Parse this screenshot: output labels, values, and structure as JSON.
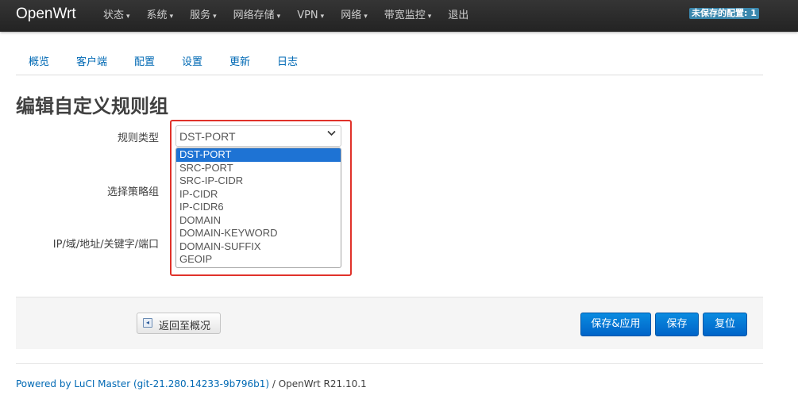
{
  "navbar": {
    "brand": "OpenWrt",
    "menu": [
      "状态",
      "系统",
      "服务",
      "网络存储",
      "VPN",
      "网络",
      "带宽监控",
      "退出"
    ],
    "unsaved_badge": "未保存的配置: 1"
  },
  "tabs": [
    "概览",
    "客户端",
    "配置",
    "设置",
    "更新",
    "日志"
  ],
  "page": {
    "title": "编辑自定义规则组"
  },
  "form": {
    "rule_type_label": "规则类型",
    "policy_group_label": "选择策略组",
    "target_label": "IP/域/地址/关键字/端口",
    "rule_type_selected": "DST-PORT",
    "rule_type_options": [
      "DST-PORT",
      "SRC-PORT",
      "SRC-IP-CIDR",
      "IP-CIDR",
      "IP-CIDR6",
      "DOMAIN",
      "DOMAIN-KEYWORD",
      "DOMAIN-SUFFIX",
      "GEOIP"
    ]
  },
  "actions": {
    "back": "返回至概况",
    "save_apply": "保存&应用",
    "save": "保存",
    "reset": "复位"
  },
  "footer": {
    "powered_by": "Powered by LuCI Master (git-21.280.14233-9b796b1)",
    "separator": " / ",
    "version": "OpenWrt R21.10.1"
  },
  "colors": {
    "navbar": "#2b2b2b",
    "link": "#0069b4",
    "primary_button": "#0a7fd8",
    "highlight": "#e0322a",
    "selected_option": "#1e73d4"
  }
}
